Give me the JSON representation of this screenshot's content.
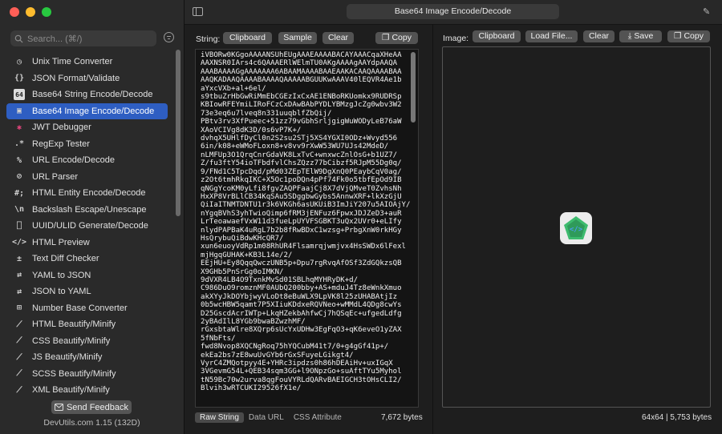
{
  "window_title": "Base64 Image Encode/Decode",
  "search": {
    "placeholder": "Search... (⌘/)"
  },
  "sidebar": {
    "items": [
      {
        "label": "Unix Time Converter",
        "icon": "clock-icon",
        "glyph": "◷"
      },
      {
        "label": "JSON Format/Validate",
        "icon": "braces-icon",
        "glyph": "{}"
      },
      {
        "label": "Base64 String Encode/Decode",
        "icon": "base64-icon",
        "glyph": "64"
      },
      {
        "label": "Base64 Image Encode/Decode",
        "icon": "image-icon",
        "glyph": "▣",
        "active": true
      },
      {
        "label": "JWT Debugger",
        "icon": "jwt-icon",
        "glyph": "✱"
      },
      {
        "label": "RegExp Tester",
        "icon": "regexp-icon",
        "glyph": ".*"
      },
      {
        "label": "URL Encode/Decode",
        "icon": "percent-icon",
        "glyph": "%"
      },
      {
        "label": "URL Parser",
        "icon": "link-icon",
        "glyph": "⊘"
      },
      {
        "label": "HTML Entity Encode/Decode",
        "icon": "hash-icon",
        "glyph": "#;"
      },
      {
        "label": "Backslash Escape/Unescape",
        "icon": "backslash-icon",
        "glyph": "\\n"
      },
      {
        "label": "UUID/ULID Generate/Decode",
        "icon": "uuid-icon",
        "glyph": "⎕"
      },
      {
        "label": "HTML Preview",
        "icon": "code-icon",
        "glyph": "</>"
      },
      {
        "label": "Text Diff Checker",
        "icon": "diff-icon",
        "glyph": "±"
      },
      {
        "label": "YAML to JSON",
        "icon": "convert-icon",
        "glyph": "⇄"
      },
      {
        "label": "JSON to YAML",
        "icon": "convert-icon",
        "glyph": "⇄"
      },
      {
        "label": "Number Base Converter",
        "icon": "number-icon",
        "glyph": "⊞"
      },
      {
        "label": "HTML Beautify/Minify",
        "icon": "wand-icon",
        "glyph": "⟋"
      },
      {
        "label": "CSS Beautify/Minify",
        "icon": "wand-icon",
        "glyph": "⟋"
      },
      {
        "label": "JS Beautify/Minify",
        "icon": "wand-icon",
        "glyph": "⟋"
      },
      {
        "label": "SCSS Beautify/Minify",
        "icon": "wand-icon",
        "glyph": "⟋"
      },
      {
        "label": "XML Beautify/Minify",
        "icon": "wand-icon",
        "glyph": "⟋"
      }
    ]
  },
  "feedback_label": "Send Feedback",
  "version": "DevUtils.com 1.15 (132D)",
  "left": {
    "label": "String:",
    "clipboard": "Clipboard",
    "sample": "Sample",
    "clear": "Clear",
    "copy": "Copy",
    "text": "iVBORw0KGgoAAAANSUhEUgAAAEAAAABACAYAAACqaXHeAA\nAAXNSR0IArs4c6QAAAERlWElmTU0AKgAAAAgAAYdpAAQA\nAAABAAAAGgAAAAAAA6ABAAMAAAABAAEAAKACAAQAAAABAA\nAAQKADAAQAAAABAAAAQAAAAABGUUKwAAAV40lEQVR4Ae1b\naYxcVXb+al+6el/\ns9tbuZrHbGwRiMmEbCGEzIxCxAE1ENBoRKUomkx9RUDRSp\nKBIowRFEYmiLIRoFCzCxDAwBAbPYDLYBMzgJcZg0wbv3W2\n73e3eq6u7lveq8n331uuqblfZbQij/\nPBtv3rv3XfPueec+51zz79vGbhSrljgigWuWODyLeB76aW\nXAoVCIVg8dK3D/0s6vP7K+/\ndvhqX5UHlfDyCl0n2S2su2STj5XS4YGXI0ODz+Wvyd556\n6in/k08+eWMoFLoxn8+v8vv9rXwW53WU7UJs42MdeD/\nnLMFUp3O1QrqCnrGdaVK8LxTvC+wnxwcZnlOsG+b1UZ7/\nZ/fu3ftY54ioTFbdfvlChsZQzz77bCibzf5RJpM55Dg0q/\n9/FNd1C5TpcDqd/pMd03ZEpTElW9DgXnQ0PEaybCqV0ag/\nz2Ot6tmhRkqIKC+X5Oc1poDQn4pPf74Fk0o5tbfEpOd9IB\nqNGgYcoKM0yLfi8fgvZAQPFaajCj8X7dVjQMveT0ZvhsNh\nHxXP8VrBLlCB34KqSAu5SDggbwGybs5AnnwXRF+lkXzGjU\nQiIaITNMTDNTU1r3k6VKGh6asUKUiB3ImJiY207u5AIOAjY/\nnYgqBVhS3yhTwioQimp6fRM3jENFuz6FpwxJDJZeD3+auR\nLrTeoawaefVxW11d3fueLpUYVFSGBKT3uQx2UVr0+eLIfy\nnlydPAPBaK4uRgL7b2b8fRwBDxC1wzsg+PrbgXnW0rkHGy\nHsQrybuQiBdwKHcQR7/\nxun6euoyVdRp1m08RhUR4Flsamrqjwmjvx4HsSWDx6lFexl\nmjHgqGUHAK+KB3L14e/2/\nEEjHU+Ey8QqqQwczUNB5p+Dpu7rgRvqAfOSf3ZdGQkzsQB\nX9GHb5PnSrGg0oIMKN/\n9dVXR4LB4O9TxnkMvSd01SBLhqMYHRyDK+d/\nC986DuO9romznMF0AUbQ200bby+AS+mduJ4Tz8eWnkXmuo\nakXYyJkDOYbjwyVLoDt8eBuWLX9LpVK8l25zUHABAtjIz\n0b5wcHBW5qamt7P5XIiuKDdxeRQVNeo+wMMdL4QDg8cwYs\nD25GscdAcrIWTp+LkqHZekbAhfwCj7hQSqEc+ufgedLdfg\n2yBAdIlL8YGb9bwaBZwzhMF/\nrGxsbtaWlre8XQrp6sUcYxUDHw3EgFqO3+qK6eveO1yZAX\n5fNbFts/\nfwd8Nvop8XQCNgRoq75hYQCubM41t7/0+g4gGf41p+/\nekEa2bs7zE8wuUvGYb6rGxSFuyeLGikgt4/\nVyrC4ZMQotpyy4E+YHRc3ipdzs0h86hDEAiHv+uxIGqX\n3VGevmG54L+QEB34sqm3GG+l9ONpzGo+suAftTYu5Myhol\ntN59Bc70w2urva8qgFouVYRLdQARvBAEIGCH3tOHsCLI2/\nBlvih3wRTCUKI29526fX1e/"
  },
  "left_tabs": [
    "Raw String",
    "Data URL",
    "CSS Attribute"
  ],
  "left_bytes": "7,672 bytes",
  "right": {
    "label": "Image:",
    "clipboard": "Clipboard",
    "load": "Load File...",
    "clear": "Clear",
    "save": "Save",
    "copy": "Copy",
    "info": "64x64 | 5,753 bytes"
  },
  "colors": {
    "accent": "#2e5ec2",
    "red": "#ff5f57",
    "yellow": "#febc2e",
    "green": "#28c840",
    "thumb_green": "#3dbb6e"
  }
}
